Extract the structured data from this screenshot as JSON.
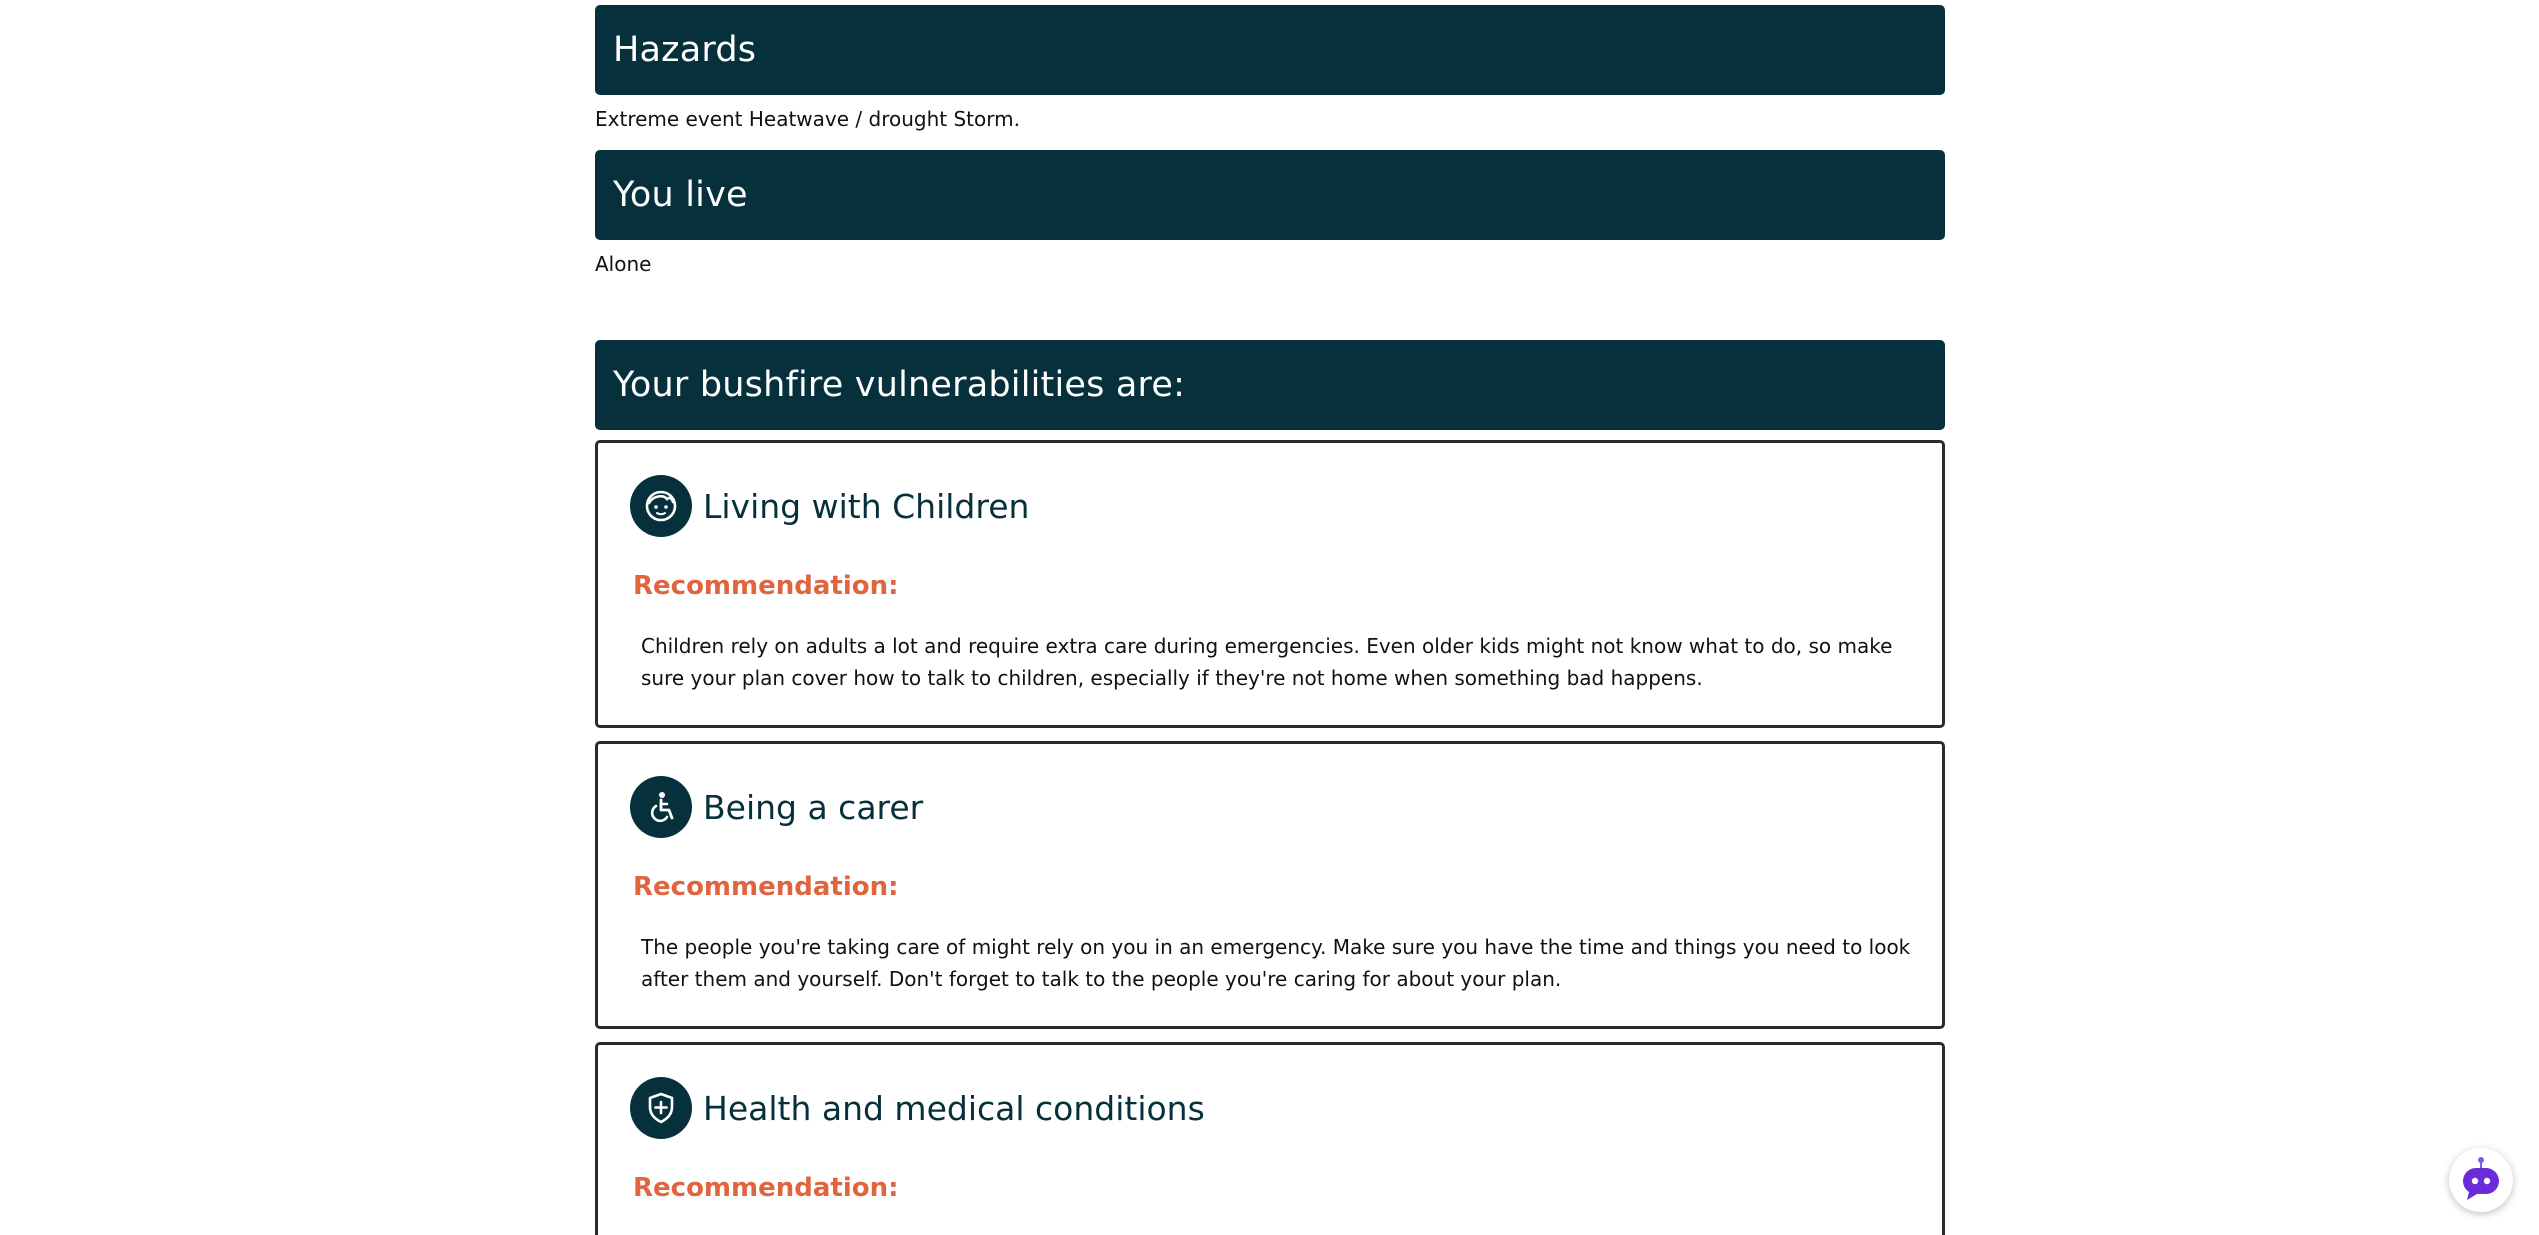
{
  "sections": {
    "hazards": {
      "heading": "Hazards",
      "text": "Extreme event Heatwave / drought Storm."
    },
    "you_live": {
      "heading": "You live",
      "text": "Alone"
    },
    "vulnerabilities_heading": "Your bushfire vulnerabilities are:"
  },
  "cards": [
    {
      "title": "Living with Children",
      "icon": "child-face-icon",
      "rec_label": "Recommendation:",
      "rec_text": "Children rely on adults a lot and require extra care during emergencies. Even older kids might not know what to do, so make sure your plan cover how to talk to children, especially if they're not home when something bad happens."
    },
    {
      "title": "Being a carer",
      "icon": "accessibility-icon",
      "rec_label": "Recommendation:",
      "rec_text": "The people you're taking care of might rely on you in an emergency. Make sure you have the time and things you need to look after them and yourself. Don't forget to talk to the people you're caring for about your plan."
    },
    {
      "title": "Health and medical conditions",
      "icon": "medical-shield-icon",
      "rec_label": "Recommendation:",
      "rec_text": ""
    }
  ],
  "chatbot": {
    "icon": "chatbot-icon"
  },
  "colors": {
    "banner": "#06303b",
    "accent": "#e0643d",
    "chatbot": "#6a2bd9"
  }
}
